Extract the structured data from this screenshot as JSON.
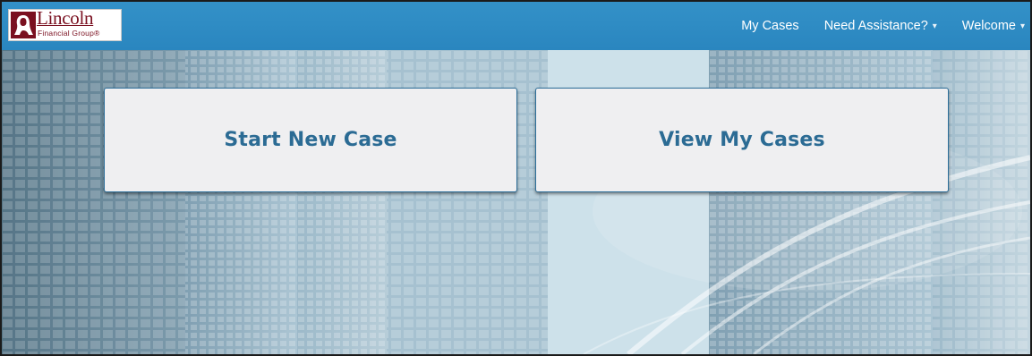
{
  "brand": {
    "name": "Lincoln",
    "subtitle": "Financial Group®"
  },
  "nav": {
    "items": [
      {
        "label": "My Cases",
        "dropdown": false
      },
      {
        "label": "Need Assistance?",
        "dropdown": true
      },
      {
        "label": "Welcome",
        "dropdown": true
      }
    ],
    "caret": "▾"
  },
  "tiles": {
    "start_new_case": "Start New Case",
    "view_my_cases": "View My Cases"
  },
  "colors": {
    "navbar": "#2f8cc4",
    "tile_text": "#2b6b94",
    "tile_bg": "#efeff1",
    "brand_red": "#7a1020"
  },
  "icons": [
    "lincoln-logo-icon",
    "chevron-down-icon"
  ]
}
